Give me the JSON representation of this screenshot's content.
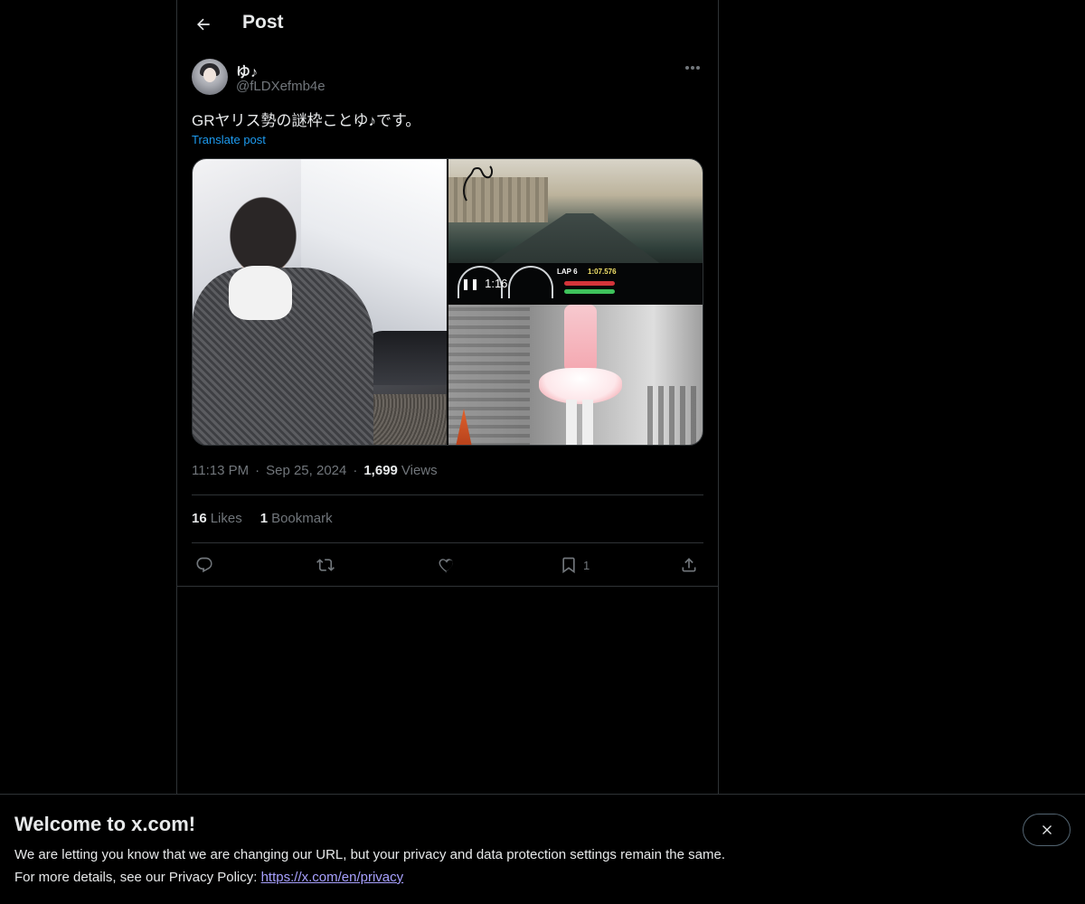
{
  "header": {
    "title": "Post"
  },
  "author": {
    "display_name": "ゆ♪",
    "handle": "@fLDXefmb4e"
  },
  "post": {
    "text": "GRヤリス勢の謎枠ことゆ♪です。",
    "translate_label": "Translate post",
    "video": {
      "duration": "1:16",
      "lap_label": "LAP 6",
      "lap_time": "1:07.576"
    },
    "time": "11:13 PM",
    "date": "Sep 25, 2024",
    "views_count": "1,699",
    "views_label": "Views"
  },
  "stats": {
    "likes_count": "16",
    "likes_label": "Likes",
    "bookmarks_count": "1",
    "bookmarks_label": "Bookmark"
  },
  "actions": {
    "bookmark_count": "1"
  },
  "banner": {
    "title": "Welcome to x.com!",
    "line1": "We are letting you know that we are changing our URL, but your privacy and data protection settings remain the same.",
    "line2_prefix": "For more details, see our Privacy Policy: ",
    "link_text": "https://x.com/en/privacy"
  },
  "colors": {
    "background": "#000000",
    "text_primary": "#e7e9ea",
    "text_secondary": "#71767b",
    "accent": "#1d9bf0",
    "border": "#2f3336",
    "link": "#a8a1ff"
  }
}
